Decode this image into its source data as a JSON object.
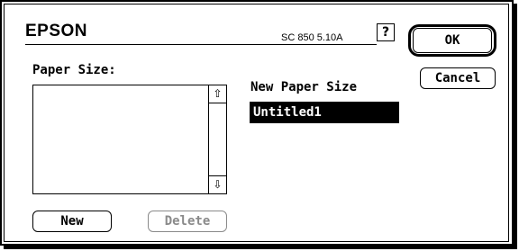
{
  "dialog": {
    "brand": "EPSON",
    "version": "SC 850 5.10A",
    "help_icon": "help-balloon-icon"
  },
  "buttons": {
    "ok": "OK",
    "cancel": "Cancel",
    "new": "New",
    "delete": "Delete"
  },
  "paper_size": {
    "label": "Paper Size:",
    "items": []
  },
  "new_paper_size": {
    "label": "New Paper Size",
    "value": "Untitled1"
  },
  "scrollbar": {
    "up_icon": "scroll-up-arrow-icon",
    "down_icon": "scroll-down-arrow-icon"
  }
}
